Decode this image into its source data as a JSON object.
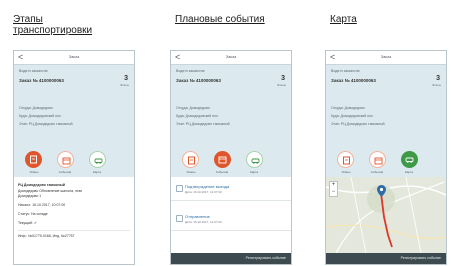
{
  "headings": {
    "stages": "Этапы транспортировки",
    "events": "Плановые события",
    "map": "Карта"
  },
  "screen": {
    "title": "Заказ",
    "back": "<",
    "vehicle_id": "Водитл заказчтов",
    "order": "Заказ № 4100000063",
    "count": "3",
    "count_label": "Этапы",
    "from": "Откуда: Домодедово",
    "to": "Куда: Домодедовский пос.",
    "status": "Этап: РЦ Домодедово таможный"
  },
  "actions": [
    {
      "label": "Этапы",
      "icon": "clipboard-icon"
    },
    {
      "label": "События",
      "icon": "calendar-icon"
    },
    {
      "label": "Карта",
      "icon": "car-icon"
    }
  ],
  "stage_detail": {
    "line1": "РЦ Домодедово таможный",
    "line2": "Домодедово Обновление шалона, этап",
    "line3": "Домодедово 1",
    "start": "Начало: 16.10.2017, 10:07:00",
    "status": "Статус: На складе",
    "current": "Текущий:",
    "footer_line": "Инф.: №01779-0168, Инд. №27757"
  },
  "events": [
    {
      "title": "Подтверждение выезда",
      "date": "Дата: 16.10.2017, 14:07:00"
    },
    {
      "title": "Отправление",
      "date": "Дата: 16.10.2017, 14:07:00"
    }
  ],
  "footer_button": "Регистрировать событие",
  "colors": {
    "accent_orange": "#e0562c",
    "light_orange": "#f3b29c",
    "accent_green": "#3e9a46",
    "light_green": "#a9d3ad",
    "phone_bg": "#dceaef",
    "footer_bg": "#3d4a50"
  }
}
